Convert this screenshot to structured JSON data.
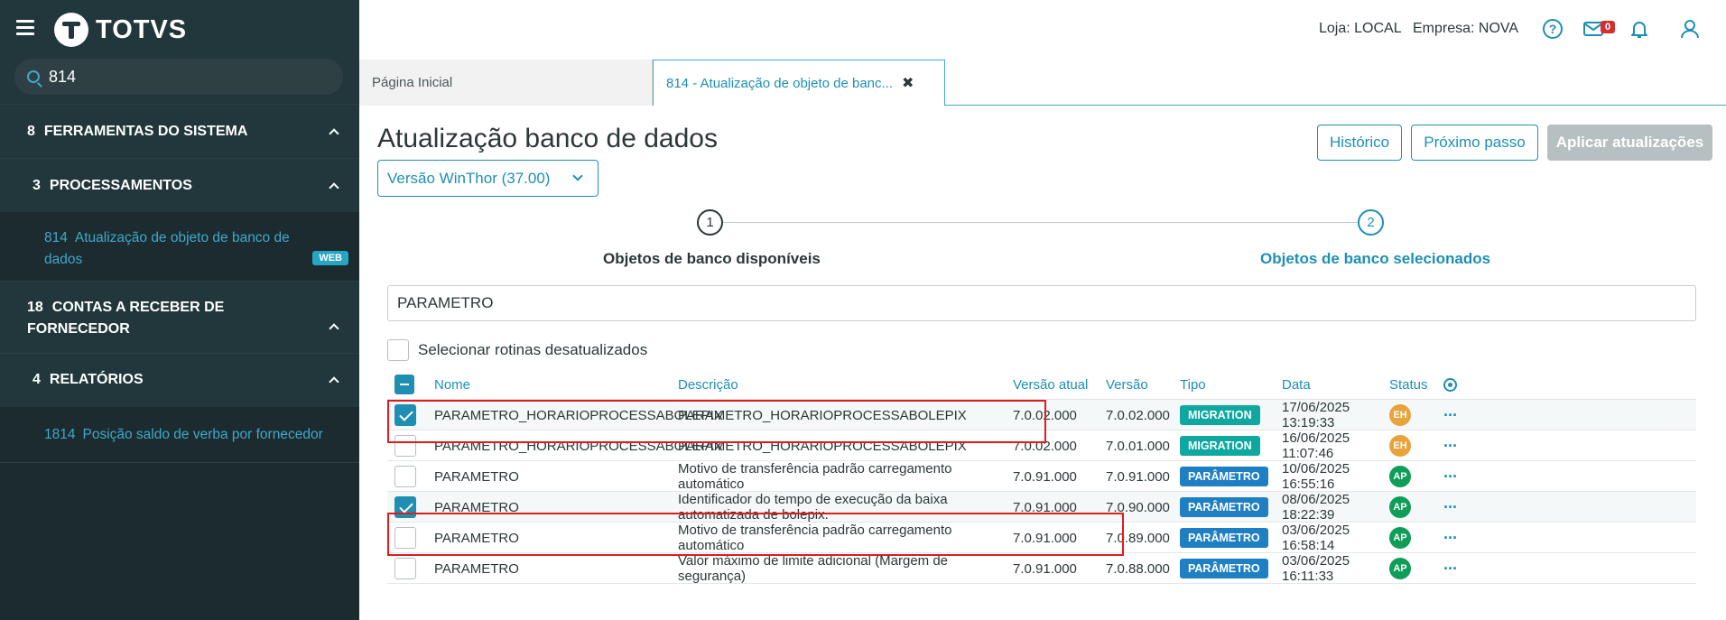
{
  "sidebar": {
    "logo_text": "TOTVS",
    "search_value": "814",
    "groups": [
      {
        "num": "8",
        "label": "FERRAMENTAS DO SISTEMA"
      },
      {
        "num": "3",
        "label": "PROCESSAMENTOS",
        "item_num": "814",
        "item_label_1": "Atualização de objeto de banco de",
        "item_label_2": "dados",
        "item_badge": "WEB"
      },
      {
        "num": "18",
        "label_1": "CONTAS A RECEBER DE",
        "label_2": "FORNECEDOR"
      },
      {
        "num": "4",
        "label": "RELATÓRIOS",
        "item_num": "1814",
        "item_label": "Posição saldo de verba por fornecedor"
      }
    ]
  },
  "header": {
    "loja": "Loja: LOCAL",
    "empresa": "Empresa: NOVA",
    "mail_count": "0"
  },
  "tabs": {
    "home": "Página Inicial",
    "active": "814 - Atualização de objeto de banc..."
  },
  "main": {
    "title": "Atualização banco de dados",
    "btn_historico": "Histórico",
    "btn_proximo": "Próximo passo",
    "btn_aplicar": "Aplicar atualizações",
    "version_select": "Versão WinThor (37.00)",
    "step1_num": "1",
    "step1_label": "Objetos de banco disponíveis",
    "step2_num": "2",
    "step2_label": "Objetos de banco selecionados",
    "filter_value": "PARAMETRO",
    "select_outdated_label": "Selecionar rotinas desatualizados"
  },
  "table": {
    "headers": {
      "nome": "Nome",
      "descricao": "Descrição",
      "versao_atual": "Versão atual",
      "versao": "Versão",
      "tipo": "Tipo",
      "data": "Data",
      "status": "Status"
    },
    "rows": [
      {
        "checked": true,
        "nome": "PARAMETRO_HORARIOPROCESSABOLEPIX",
        "descricao": "PARAMETRO_HORARIOPROCESSABOLEPIX",
        "versao_atual": "7.0.02.000",
        "versao": "7.0.02.000",
        "tipo": "MIGRATION",
        "data1": "17/06/2025",
        "data2": "13:19:33",
        "status": "EH"
      },
      {
        "checked": false,
        "nome": "PARAMETRO_HORARIOPROCESSABOLEPIX",
        "descricao": "PARAMETRO_HORARIOPROCESSABOLEPIX",
        "versao_atual": "7.0.02.000",
        "versao": "7.0.01.000",
        "tipo": "MIGRATION",
        "data1": "16/06/2025",
        "data2": "11:07:46",
        "status": "EH"
      },
      {
        "checked": false,
        "nome": "PARAMETRO",
        "descricao": "Motivo de transferência padrão carregamento automático",
        "versao_atual": "7.0.91.000",
        "versao": "7.0.91.000",
        "tipo": "PARÂMETRO",
        "data1": "10/06/2025",
        "data2": "16:55:16",
        "status": "AP"
      },
      {
        "checked": true,
        "nome": "PARAMETRO",
        "descricao": "Identificador do tempo de execução da baixa automatizada de bolepix.",
        "versao_atual": "7.0.91.000",
        "versao": "7.0.90.000",
        "tipo": "PARÂMETRO",
        "data1": "08/06/2025",
        "data2": "18:22:39",
        "status": "AP"
      },
      {
        "checked": false,
        "nome": "PARAMETRO",
        "descricao": "Motivo de transferência padrão carregamento automático",
        "versao_atual": "7.0.91.000",
        "versao": "7.0.89.000",
        "tipo": "PARÂMETRO",
        "data1": "03/06/2025",
        "data2": "16:58:14",
        "status": "AP"
      },
      {
        "checked": false,
        "nome": "PARAMETRO",
        "descricao": "Valor máximo de limite adicional (Margem de segurança)",
        "versao_atual": "7.0.91.000",
        "versao": "7.0.88.000",
        "tipo": "PARÂMETRO",
        "data1": "03/06/2025",
        "data2": "16:11:33",
        "status": "AP"
      }
    ]
  },
  "colors": {
    "accent": "#1e8fb3",
    "sidebar_bg": "#1c2b2f",
    "highlight": "#e01b1b",
    "migration": "#0fa8a0",
    "parametro": "#1e7fc3"
  }
}
